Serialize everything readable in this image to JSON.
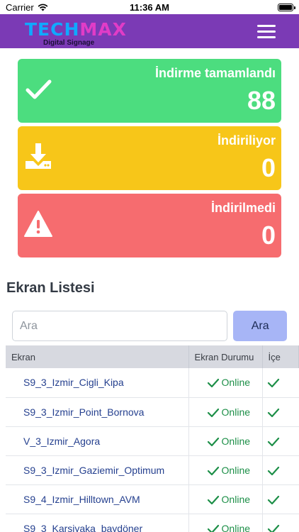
{
  "status_bar": {
    "carrier": "Carrier",
    "time": "11:36 AM"
  },
  "navbar": {
    "logo_main_a": "TECH",
    "logo_main_b": "MAX",
    "logo_sub": "Digital Signage"
  },
  "cards": [
    {
      "label": "İndirme tamamlandı",
      "value": "88",
      "color": "#4cdd7f",
      "icon": "check-icon"
    },
    {
      "label": "İndiriliyor",
      "value": "0",
      "color": "#f7c619",
      "icon": "download-icon"
    },
    {
      "label": "İndirilmedi",
      "value": "0",
      "color": "#f66c6f",
      "icon": "warning-icon"
    }
  ],
  "screen_list": {
    "title": "Ekran Listesi",
    "search_placeholder": "Ara",
    "search_button": "Ara",
    "columns": [
      "Ekran",
      "Ekran Durumu",
      "İçe"
    ],
    "rows": [
      {
        "name": "S9_3_Izmir_Cigli_Kipa",
        "status": "Online"
      },
      {
        "name": "S9_3_Izmir_Point_Bornova",
        "status": "Online"
      },
      {
        "name": "V_3_Izmir_Agora",
        "status": "Online"
      },
      {
        "name": "S9_3_Izmir_Gaziemir_Optimum",
        "status": "Online"
      },
      {
        "name": "S9_4_Izmir_Hilltown_AVM",
        "status": "Online"
      },
      {
        "name": "S9_3_Karsiyaka_baydöner",
        "status": "Online"
      }
    ]
  },
  "colors": {
    "navbar": "#7b3ab5",
    "online": "#1d8f48",
    "link": "#25408f",
    "button": "#a7b5f6"
  }
}
